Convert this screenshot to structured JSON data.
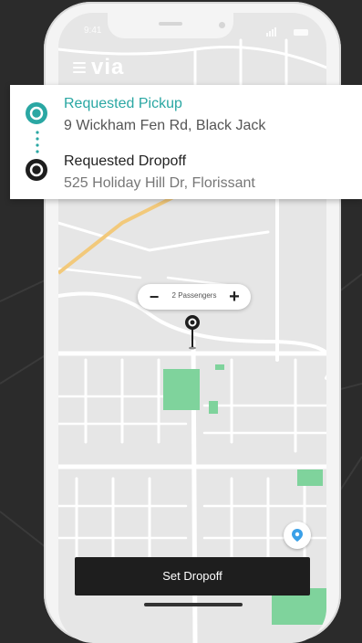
{
  "status_bar": {
    "time": "9:41"
  },
  "header": {
    "logo": "via"
  },
  "route": {
    "pickup": {
      "label": "Requested Pickup",
      "address": "9 Wickham Fen Rd, Black Jack"
    },
    "dropoff": {
      "label": "Requested Dropoff",
      "address": "525 Holiday Hill Dr, Florissant"
    }
  },
  "passengers": {
    "text": "2 Passengers",
    "minus": "−",
    "plus": "+"
  },
  "cta": {
    "label": "Set Dropoff"
  },
  "icons": {
    "menu": "menu-icon",
    "pickup": "pickup-pin-icon",
    "dropoff": "dropoff-pin-icon",
    "map_pin": "map-pin-icon",
    "locate": "location-icon"
  },
  "colors": {
    "accent": "#2aa7a3",
    "button": "#1e1e1e",
    "park": "#7fd39c"
  }
}
